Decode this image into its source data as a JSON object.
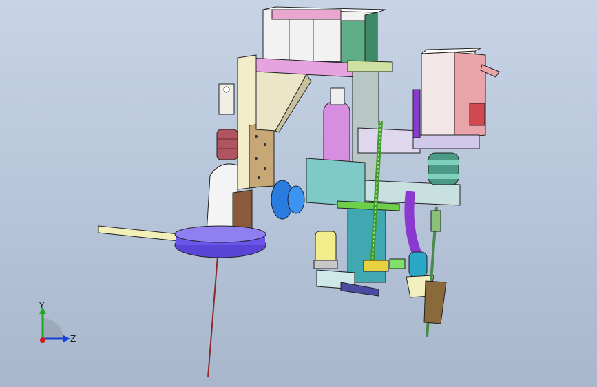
{
  "viewport": {
    "background_top": "#c7d4e6",
    "background_bottom": "#a8b7cc"
  },
  "triad": {
    "y_label": "Y",
    "z_label": "Z",
    "y_color": "#1fa81f",
    "z_color": "#1a3fd6",
    "x_color": "#d11a1a"
  },
  "model": {
    "parts": [
      "top-block",
      "top-green-housing",
      "pink-crossbar",
      "left-mount-plate",
      "left-bracket",
      "left-red-coupling",
      "left-column",
      "left-base-disc",
      "left-rod",
      "left-probe",
      "magenta-cylinder",
      "blue-knob",
      "center-slide",
      "green-leadscrew",
      "servo-motor",
      "motor-coupling",
      "purple-nozzle",
      "right-needle",
      "lower-gripper",
      "yellow-cylinder"
    ]
  }
}
